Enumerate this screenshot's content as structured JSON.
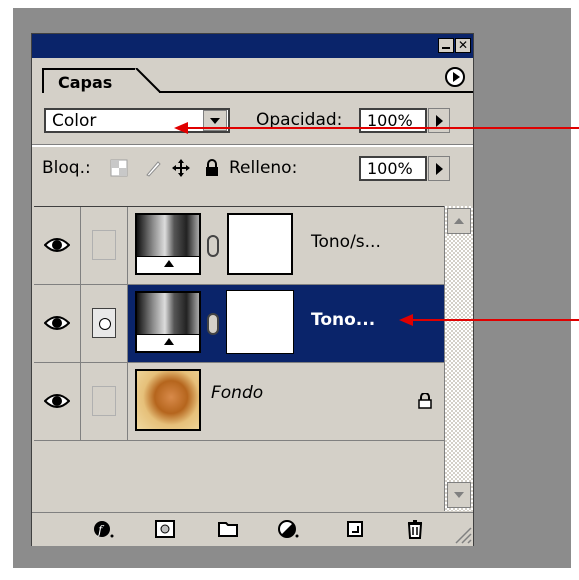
{
  "panel": {
    "tab_label": "Capas",
    "blend_mode": "Color",
    "opacity_label": "Opacidad:",
    "opacity_value": "100%",
    "lock_label": "Bloq.:",
    "fill_label": "Relleno:",
    "fill_value": "100%"
  },
  "layers": [
    {
      "name": "Tono/s...",
      "visible": true,
      "selected": false,
      "type": "adjustment"
    },
    {
      "name": "Tono...",
      "visible": true,
      "selected": true,
      "type": "adjustment"
    },
    {
      "name": "Fondo",
      "visible": true,
      "selected": false,
      "type": "background",
      "locked": true
    }
  ],
  "bottom_toolbar": [
    "link-layers-icon",
    "add-layer-style-icon",
    "add-mask-icon",
    "new-group-icon",
    "adjustment-layer-icon",
    "new-layer-icon",
    "trash-icon"
  ],
  "colors": {
    "title_bar": "#0a246a",
    "selection": "#0a246a",
    "panel_bg": "#d4d0c8",
    "arrow": "#e00000"
  }
}
